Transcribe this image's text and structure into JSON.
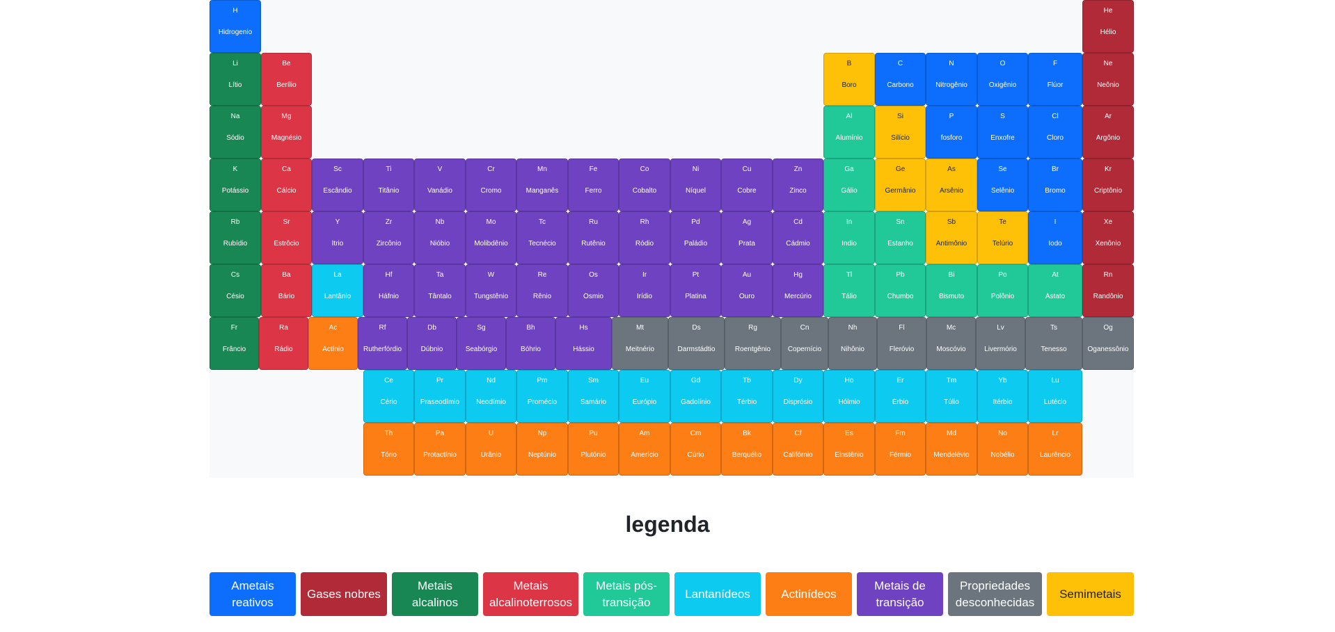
{
  "colors": {
    "reactive_nonmetal": "#0d6efd",
    "noble_gas": "#b02a37",
    "alkali_metal": "#198754",
    "alkaline_earth_metal": "#dc3545",
    "post_transition_metal": "#20c997",
    "lanthanide": "#0dcaf0",
    "actinide": "#fd7e14",
    "transition_metal": "#6f42c1",
    "unknown": "#6c757d",
    "metalloid": "#ffc107"
  },
  "elements": [
    {
      "symbol": "H",
      "name": "Hidrogenio",
      "category": "reactive_nonmetal"
    },
    {
      "symbol": "He",
      "name": "Hélio",
      "category": "noble_gas"
    },
    {
      "symbol": "Li",
      "name": "Lítio",
      "category": "alkali_metal"
    },
    {
      "symbol": "Be",
      "name": "Berílio",
      "category": "alkaline_earth_metal"
    },
    {
      "symbol": "B",
      "name": "Boro",
      "category": "metalloid"
    },
    {
      "symbol": "C",
      "name": "Carbono",
      "category": "reactive_nonmetal"
    },
    {
      "symbol": "N",
      "name": "Nitrogênio",
      "category": "reactive_nonmetal"
    },
    {
      "symbol": "O",
      "name": "Oxigênio",
      "category": "reactive_nonmetal"
    },
    {
      "symbol": "F",
      "name": "Flúor",
      "category": "reactive_nonmetal"
    },
    {
      "symbol": "Ne",
      "name": "Neônio",
      "category": "noble_gas"
    },
    {
      "symbol": "Na",
      "name": "Sódio",
      "category": "alkali_metal"
    },
    {
      "symbol": "Mg",
      "name": "Magnésio",
      "category": "alkaline_earth_metal"
    },
    {
      "symbol": "Al",
      "name": "Alumínio",
      "category": "post_transition_metal"
    },
    {
      "symbol": "Si",
      "name": "Silício",
      "category": "metalloid"
    },
    {
      "symbol": "P",
      "name": "fosforo",
      "category": "reactive_nonmetal"
    },
    {
      "symbol": "S",
      "name": "Enxofre",
      "category": "reactive_nonmetal"
    },
    {
      "symbol": "Cl",
      "name": "Cloro",
      "category": "reactive_nonmetal"
    },
    {
      "symbol": "Ar",
      "name": "Argônio",
      "category": "noble_gas"
    },
    {
      "symbol": "K",
      "name": "Potássio",
      "category": "alkali_metal"
    },
    {
      "symbol": "Ca",
      "name": "Cálcio",
      "category": "alkaline_earth_metal"
    },
    {
      "symbol": "Sc",
      "name": "Escândio",
      "category": "transition_metal"
    },
    {
      "symbol": "Ti",
      "name": "Titânio",
      "category": "transition_metal"
    },
    {
      "symbol": "V",
      "name": "Vanádio",
      "category": "transition_metal"
    },
    {
      "symbol": "Cr",
      "name": "Cromo",
      "category": "transition_metal"
    },
    {
      "symbol": "Mn",
      "name": "Manganês",
      "category": "transition_metal"
    },
    {
      "symbol": "Fe",
      "name": "Ferro",
      "category": "transition_metal"
    },
    {
      "symbol": "Co",
      "name": "Cobalto",
      "category": "transition_metal"
    },
    {
      "symbol": "Ni",
      "name": "Níquel",
      "category": "transition_metal"
    },
    {
      "symbol": "Cu",
      "name": "Cobre",
      "category": "transition_metal"
    },
    {
      "symbol": "Zn",
      "name": "Zinco",
      "category": "transition_metal"
    },
    {
      "symbol": "Ga",
      "name": "Gálio",
      "category": "post_transition_metal"
    },
    {
      "symbol": "Ge",
      "name": "Germânio",
      "category": "metalloid"
    },
    {
      "symbol": "As",
      "name": "Arsênio",
      "category": "metalloid"
    },
    {
      "symbol": "Se",
      "name": "Selênio",
      "category": "reactive_nonmetal"
    },
    {
      "symbol": "Br",
      "name": "Bromo",
      "category": "reactive_nonmetal"
    },
    {
      "symbol": "Kr",
      "name": "Criptônio",
      "category": "noble_gas"
    },
    {
      "symbol": "Rb",
      "name": "Rubídio",
      "category": "alkali_metal"
    },
    {
      "symbol": "Sr",
      "name": "Estrôcio",
      "category": "alkaline_earth_metal"
    },
    {
      "symbol": "Y",
      "name": "Ítrio",
      "category": "transition_metal"
    },
    {
      "symbol": "Zr",
      "name": "Zircônio",
      "category": "transition_metal"
    },
    {
      "symbol": "Nb",
      "name": "Nióbio",
      "category": "transition_metal"
    },
    {
      "symbol": "Mo",
      "name": "Molibdênio",
      "category": "transition_metal"
    },
    {
      "symbol": "Tc",
      "name": "Tecnécio",
      "category": "transition_metal"
    },
    {
      "symbol": "Ru",
      "name": "Rutênio",
      "category": "transition_metal"
    },
    {
      "symbol": "Rh",
      "name": "Ródio",
      "category": "transition_metal"
    },
    {
      "symbol": "Pd",
      "name": "Paládio",
      "category": "transition_metal"
    },
    {
      "symbol": "Ag",
      "name": "Prata",
      "category": "transition_metal"
    },
    {
      "symbol": "Cd",
      "name": "Cádmio",
      "category": "transition_metal"
    },
    {
      "symbol": "In",
      "name": "Indio",
      "category": "post_transition_metal"
    },
    {
      "symbol": "Sn",
      "name": "Estanho",
      "category": "post_transition_metal"
    },
    {
      "symbol": "Sb",
      "name": "Antimônio",
      "category": "metalloid"
    },
    {
      "symbol": "Te",
      "name": "Telúrio",
      "category": "metalloid"
    },
    {
      "symbol": "I",
      "name": "Iodo",
      "category": "reactive_nonmetal"
    },
    {
      "symbol": "Xe",
      "name": "Xenônio",
      "category": "noble_gas"
    },
    {
      "symbol": "Cs",
      "name": "Césio",
      "category": "alkali_metal"
    },
    {
      "symbol": "Ba",
      "name": "Bário",
      "category": "alkaline_earth_metal"
    },
    {
      "symbol": "La",
      "name": "Lantânio",
      "category": "lanthanide"
    },
    {
      "symbol": "Hf",
      "name": "Háfnio",
      "category": "transition_metal"
    },
    {
      "symbol": "Ta",
      "name": "Tântalo",
      "category": "transition_metal"
    },
    {
      "symbol": "W",
      "name": "Tungstênio",
      "category": "transition_metal"
    },
    {
      "symbol": "Re",
      "name": "Rênio",
      "category": "transition_metal"
    },
    {
      "symbol": "Os",
      "name": "Ósmio",
      "category": "transition_metal"
    },
    {
      "symbol": "Ir",
      "name": "Irídio",
      "category": "transition_metal"
    },
    {
      "symbol": "Pt",
      "name": "Platina",
      "category": "transition_metal"
    },
    {
      "symbol": "Au",
      "name": "Ouro",
      "category": "transition_metal"
    },
    {
      "symbol": "Hg",
      "name": "Mercúrio",
      "category": "transition_metal"
    },
    {
      "symbol": "Tl",
      "name": "Tálio",
      "category": "post_transition_metal"
    },
    {
      "symbol": "Pb",
      "name": "Chumbo",
      "category": "post_transition_metal"
    },
    {
      "symbol": "Bi",
      "name": "Bismuto",
      "category": "post_transition_metal"
    },
    {
      "symbol": "Po",
      "name": "Polônio",
      "category": "post_transition_metal"
    },
    {
      "symbol": "At",
      "name": "Ástato",
      "category": "post_transition_metal"
    },
    {
      "symbol": "Rn",
      "name": "Randônio",
      "category": "noble_gas"
    },
    {
      "symbol": "Fr",
      "name": "Frâncio",
      "category": "alkali_metal"
    },
    {
      "symbol": "Ra",
      "name": "Rádio",
      "category": "alkaline_earth_metal"
    },
    {
      "symbol": "Ac",
      "name": "Actínio",
      "category": "actinide"
    },
    {
      "symbol": "Rf",
      "name": "Rutherfórdio",
      "category": "transition_metal"
    },
    {
      "symbol": "Db",
      "name": "Dúbnio",
      "category": "transition_metal"
    },
    {
      "symbol": "Sg",
      "name": "Seabórgio",
      "category": "transition_metal"
    },
    {
      "symbol": "Bh",
      "name": "Bóhrio",
      "category": "transition_metal"
    },
    {
      "symbol": "Hs",
      "name": "Hássio",
      "category": "transition_metal"
    },
    {
      "symbol": "Mt",
      "name": "Meitnério",
      "category": "unknown"
    },
    {
      "symbol": "Ds",
      "name": "Darmstádtio",
      "category": "unknown"
    },
    {
      "symbol": "Rg",
      "name": "Roentgênio",
      "category": "unknown"
    },
    {
      "symbol": "Cn",
      "name": "Copernício",
      "category": "unknown"
    },
    {
      "symbol": "Nh",
      "name": "Nihônio",
      "category": "unknown"
    },
    {
      "symbol": "Fl",
      "name": "Fleróvio",
      "category": "unknown"
    },
    {
      "symbol": "Mc",
      "name": "Moscóvio",
      "category": "unknown"
    },
    {
      "symbol": "Lv",
      "name": "Livermório",
      "category": "unknown"
    },
    {
      "symbol": "Ts",
      "name": "Tenesso",
      "category": "unknown"
    },
    {
      "symbol": "Og",
      "name": "Oganessônio",
      "category": "unknown"
    },
    {
      "symbol": "Ce",
      "name": "Cério",
      "category": "lanthanide"
    },
    {
      "symbol": "Pr",
      "name": "Praseodímio",
      "category": "lanthanide"
    },
    {
      "symbol": "Nd",
      "name": "Neodímio",
      "category": "lanthanide"
    },
    {
      "symbol": "Pm",
      "name": "Promécio",
      "category": "lanthanide"
    },
    {
      "symbol": "Sm",
      "name": "Samário",
      "category": "lanthanide"
    },
    {
      "symbol": "Eu",
      "name": "Európio",
      "category": "lanthanide"
    },
    {
      "symbol": "Gd",
      "name": "Gadolínio",
      "category": "lanthanide"
    },
    {
      "symbol": "Tb",
      "name": "Térbio",
      "category": "lanthanide"
    },
    {
      "symbol": "Dy",
      "name": "Disprósio",
      "category": "lanthanide"
    },
    {
      "symbol": "Ho",
      "name": "Hólmio",
      "category": "lanthanide"
    },
    {
      "symbol": "Er",
      "name": "Érbio",
      "category": "lanthanide"
    },
    {
      "symbol": "Tm",
      "name": "Túlio",
      "category": "lanthanide"
    },
    {
      "symbol": "Yb",
      "name": "Itérbio",
      "category": "lanthanide"
    },
    {
      "symbol": "Lu",
      "name": "Lutécio",
      "category": "lanthanide"
    },
    {
      "symbol": "Th",
      "name": "Tório",
      "category": "actinide"
    },
    {
      "symbol": "Pa",
      "name": "Protactínio",
      "category": "actinide"
    },
    {
      "symbol": "U",
      "name": "Urânio",
      "category": "actinide"
    },
    {
      "symbol": "Np",
      "name": "Neptúnio",
      "category": "actinide"
    },
    {
      "symbol": "Pu",
      "name": "Plutônio",
      "category": "actinide"
    },
    {
      "symbol": "Am",
      "name": "Amerício",
      "category": "actinide"
    },
    {
      "symbol": "Cm",
      "name": "Cúrio",
      "category": "actinide"
    },
    {
      "symbol": "Bk",
      "name": "Berquélio",
      "category": "actinide"
    },
    {
      "symbol": "Cf",
      "name": "Califórnio",
      "category": "actinide"
    },
    {
      "symbol": "Es",
      "name": "Einstênio",
      "category": "actinide"
    },
    {
      "symbol": "Fm",
      "name": "Férmio",
      "category": "actinide"
    },
    {
      "symbol": "Md",
      "name": "Mendelévio",
      "category": "actinide"
    },
    {
      "symbol": "No",
      "name": "Nobélio",
      "category": "actinide"
    },
    {
      "symbol": "Lr",
      "name": "Laurêncio",
      "category": "actinide"
    }
  ],
  "legend": {
    "title": "legenda",
    "items": [
      {
        "label": "Ametais reativos",
        "category": "reactive_nonmetal"
      },
      {
        "label": "Gases nobres",
        "category": "noble_gas"
      },
      {
        "label": "Metais alcalinos",
        "category": "alkali_metal"
      },
      {
        "label": "Metais alcalinoterrosos",
        "category": "alkaline_earth_metal"
      },
      {
        "label": "Metais pós-transição",
        "category": "post_transition_metal"
      },
      {
        "label": "Lantanídeos",
        "category": "lanthanide"
      },
      {
        "label": "Actinídeos",
        "category": "actinide"
      },
      {
        "label": "Metais de transição",
        "category": "transition_metal"
      },
      {
        "label": "Propriedades desconhecidas",
        "category": "unknown"
      },
      {
        "label": "Semimetais",
        "category": "metalloid"
      }
    ]
  }
}
